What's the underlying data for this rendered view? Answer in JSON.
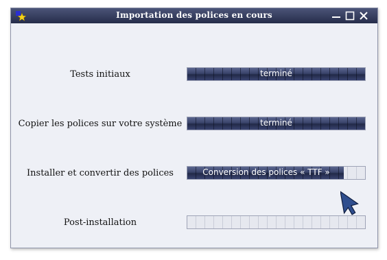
{
  "window": {
    "title": "Importation des polices en cours",
    "icon": "app-star-icon",
    "controls": [
      "minimize-icon",
      "maximize-icon",
      "close-icon"
    ]
  },
  "steps": [
    {
      "label": "Tests initiaux",
      "status_text": "terminé",
      "progress": 1.0
    },
    {
      "label": "Copier les polices sur votre système",
      "status_text": "terminé",
      "progress": 1.0
    },
    {
      "label": "Installer et convertir des polices",
      "status_text": "Conversion des polices « TTF »",
      "progress": 0.88
    },
    {
      "label": "Post-installation",
      "status_text": "",
      "progress": 0.0
    }
  ],
  "colors": {
    "titlebar": "#2f3658",
    "progress_fill": "#39436a",
    "window_bg": "#eef0f6",
    "cursor": "#2f4e8e"
  }
}
